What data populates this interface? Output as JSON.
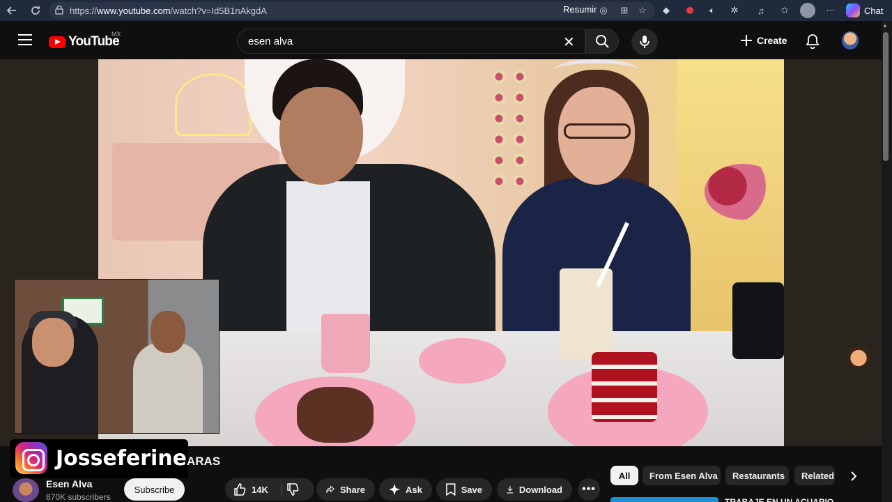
{
  "browser": {
    "url_prefix": "https://",
    "url_host": "www.youtube.com",
    "url_path": "/watch?v=Id5B1nAkgdA",
    "resumir_label": "Resumir",
    "chat_label": "Chat"
  },
  "header": {
    "logo_text": "YouTube",
    "country_code": "MX",
    "search_value": "esen alva",
    "create_label": "Create"
  },
  "overlay": {
    "instagram_handle": "Josseferine",
    "title_tail": "ARAS"
  },
  "channel": {
    "name": "Esen Alva",
    "subscribers": "870K subscribers",
    "subscribe_label": "Subscribe"
  },
  "actions": {
    "like_count": "14K",
    "share_label": "Share",
    "ask_label": "Ask",
    "save_label": "Save",
    "download_label": "Download"
  },
  "chips": [
    "All",
    "From Esen Alva",
    "Restaurants",
    "Related"
  ],
  "recommendation": {
    "title_partial": "TRABAJE EN UN ACUARIO"
  },
  "colors": {
    "brand_red": "#ff0000",
    "background": "#0f0f0f",
    "browser_bar": "#1f2a3d"
  },
  "icons": [
    "back-icon",
    "refresh-icon",
    "lock-icon",
    "menu-icon",
    "search-icon",
    "mic-icon",
    "plus-icon",
    "bell-icon",
    "like-icon",
    "dislike-icon",
    "share-icon",
    "sparkle-icon",
    "bookmark-icon",
    "download-icon",
    "more-icon",
    "chevron-right-icon",
    "instagram-icon"
  ]
}
